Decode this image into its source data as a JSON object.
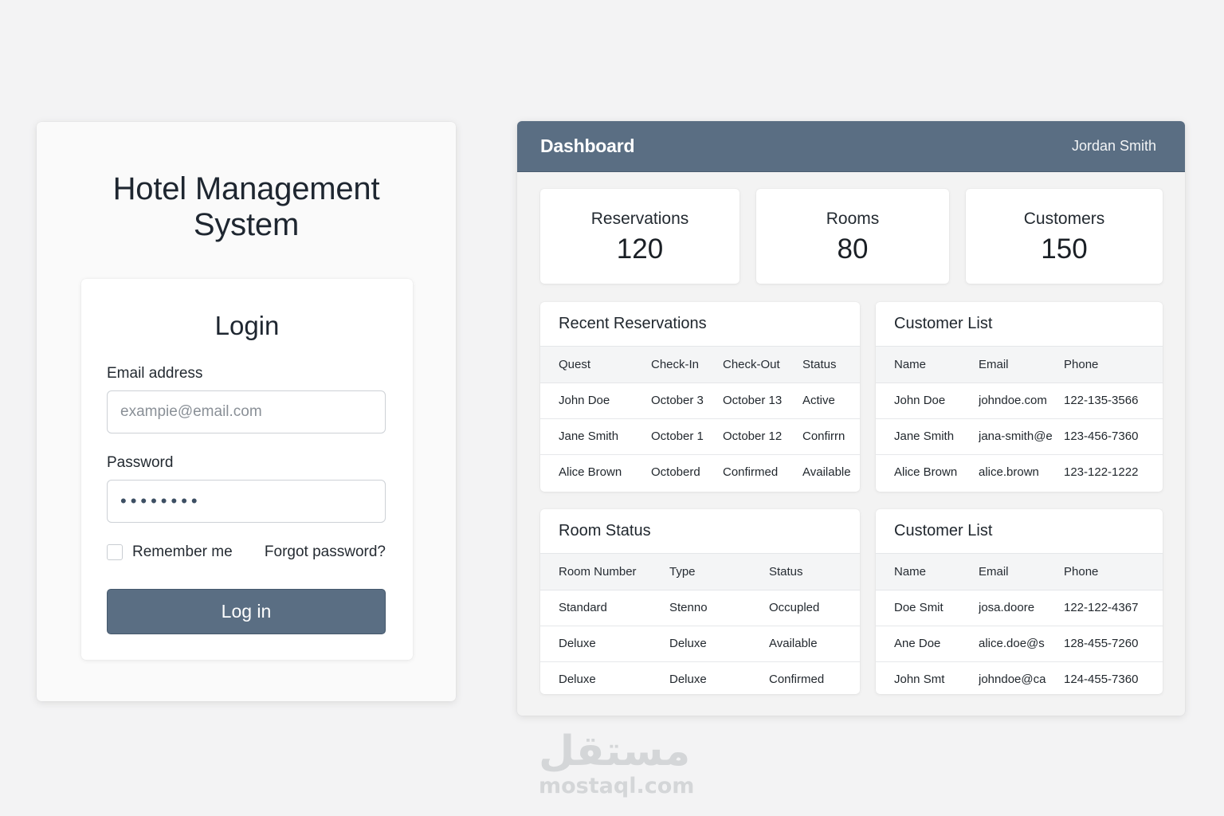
{
  "login": {
    "app_title_line1": "Hotel Management",
    "app_title_line2": "System",
    "heading": "Login",
    "email_label": "Email address",
    "email_placeholder": "exampie@email.com",
    "password_label": "Password",
    "password_value": "••••••••",
    "remember_label": "Remember me",
    "remember_checked": false,
    "forgot_label": "Forgot password?",
    "button_label": "Log in"
  },
  "dashboard": {
    "title": "Dashboard",
    "user_name": "Jordan Smith",
    "stats": [
      {
        "label": "Reservations",
        "value": "120"
      },
      {
        "label": "Rooms",
        "value": "80"
      },
      {
        "label": "Customers",
        "value": "150"
      }
    ],
    "recent_reservations": {
      "title": "Recent Reservations",
      "columns": [
        "Quest",
        "Check-In",
        "Check-Out",
        "Status"
      ],
      "rows": [
        [
          "John Doe",
          "October 3",
          "October 13",
          "Active"
        ],
        [
          "Jane Smith",
          "October 1",
          "October 12",
          "Confirrn"
        ],
        [
          "Alice Brown",
          "Octoberd",
          "Confirmed",
          "Available"
        ]
      ]
    },
    "customer_list_1": {
      "title": "Customer List",
      "columns": [
        "Name",
        "Email",
        "Phone"
      ],
      "rows": [
        [
          "John Doe",
          "johndoe.com",
          "122-135-3566"
        ],
        [
          "Jane Smith",
          "jana-smith@e",
          "123-456-7360"
        ],
        [
          "Alice Brown",
          "alice.brown",
          "123-122-1222"
        ]
      ]
    },
    "room_status": {
      "title": "Room Status",
      "columns": [
        "Room Number",
        "Type",
        "Status"
      ],
      "rows": [
        [
          "Standard",
          "Stenno",
          "Occupled"
        ],
        [
          "Deluxe",
          "Deluxe",
          "Available"
        ],
        [
          "Deluxe",
          "Deluxe",
          "Confirmed"
        ]
      ]
    },
    "customer_list_2": {
      "title": "Customer List",
      "columns": [
        "Name",
        "Email",
        "Phone"
      ],
      "rows": [
        [
          "Doe Smit",
          "josa.doore",
          "122-122-4367"
        ],
        [
          "Ane Doe",
          "alice.doe@s",
          "128-455-7260"
        ],
        [
          "John Smt",
          "johndoe@ca",
          "124-455-7360"
        ]
      ]
    }
  },
  "watermark": {
    "arabic": "مستقل",
    "latin": "mostaql.com"
  },
  "colors": {
    "accent": "#5a6e83",
    "background": "#f3f3f4",
    "card": "#ffffff"
  }
}
